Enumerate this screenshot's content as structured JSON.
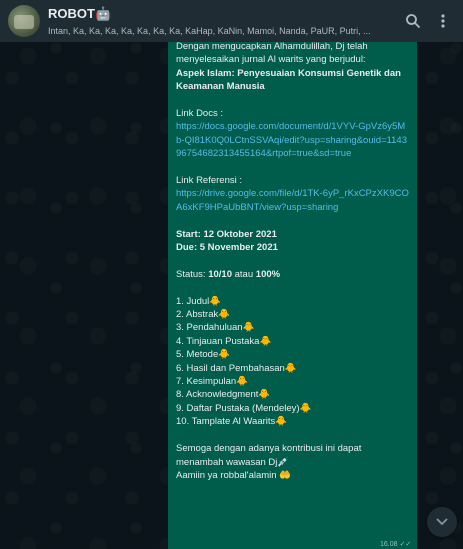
{
  "header": {
    "title": "ROBOT🤖",
    "subtitle": "Intan, Ka, Ka, Ka, Ka, Ka, Ka, Ka, KaHap, KaNin, Mamoi, Nanda, PaUR, Putri, ...",
    "search_icon": "search-icon",
    "menu_icon": "more-vert-icon"
  },
  "message": {
    "intro": "Dengan mengucapkan Alhamdulillah, Dj telah menyelesaikan jurnal Al warits yang berjudul:",
    "topic": "Aspek Islam: Penyesuaian Konsumsi Genetik dan Keamanan Manusia",
    "docs_label": "Link Docs :",
    "docs_url": "https://docs.google.com/document/d/1VYV-GpVz6y5Mb-QI81K0Q0LCtnSSVAqi/edit?usp=sharing&ouid=114396754682313455164&rtpof=true&sd=true",
    "ref_label": "Link Referensi :",
    "ref_url": "https://drive.google.com/file/d/1TK-6yP_rKxCPzXK9COA6xKF9HPaUbBNT/view?usp=sharing",
    "start": "Start: 12 Oktober 2021",
    "due": "Due: 5 November 2021",
    "status_prefix": "Status: ",
    "status_score": "10/10",
    "status_mid": " atau ",
    "status_pct": "100%",
    "items": [
      "1. Judul🐥",
      "2. Abstrak🐥",
      "3. Pendahuluan🐥",
      "4. Tinjauan Pustaka🐥",
      "5. Metode🐥",
      "6. Hasil dan Pembahasan🐥",
      "7. Kesimpulan🐥",
      "8. Acknowledgment🐥",
      "9. Daftar Pustaka (Mendeley)🐥",
      "10. Tamplate Al Waarits🐥"
    ],
    "closing1": "Semoga dengan adanya kontribusi ini dapat menambah wawasan Dj💉",
    "closing2": "Aamiin ya robbal'alamin 🤲",
    "time": "16.08 ✓✓"
  },
  "scroll_down_icon": "chevron-down-icon"
}
